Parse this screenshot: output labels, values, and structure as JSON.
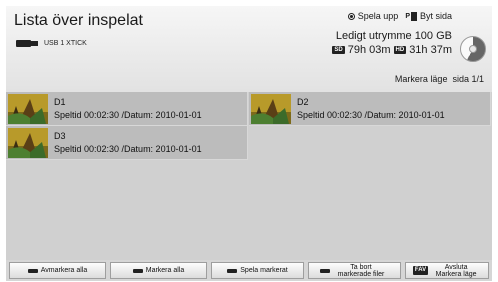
{
  "header": {
    "title": "Lista över inspelat",
    "device_label": "USB 1 XTICK",
    "legend_play": "Spela upp",
    "legend_page": "Byt sida",
    "free_space": "Ledigt utrymme 100 GB",
    "sd_badge": "SD",
    "sd_time": "79h 03m",
    "hd_badge": "HD",
    "hd_time": "31h 37m",
    "mark_mode": "Markera läge",
    "page_info": "sida 1/1"
  },
  "recordings": [
    {
      "name": "D1",
      "meta": "Speltid 00:02:30 /Datum: 2010-01-01"
    },
    {
      "name": "D2",
      "meta": "Speltid 00:02:30 /Datum: 2010-01-01"
    },
    {
      "name": "D3",
      "meta": "Speltid 00:02:30 /Datum: 2010-01-01"
    }
  ],
  "buttons": {
    "unmark_all": "Avmarkera alla",
    "mark_all": "Markera alla",
    "play_marked": "Spela markerat",
    "delete_marked": "Ta bort markerade filer",
    "fav_badge": "FAV",
    "exit_mark_mode": "Avsluta Markera läge"
  },
  "colors": {
    "header_bg": "#ececec",
    "grid_bg": "#d0d0d0",
    "item_bg": "#bcbcbc"
  }
}
